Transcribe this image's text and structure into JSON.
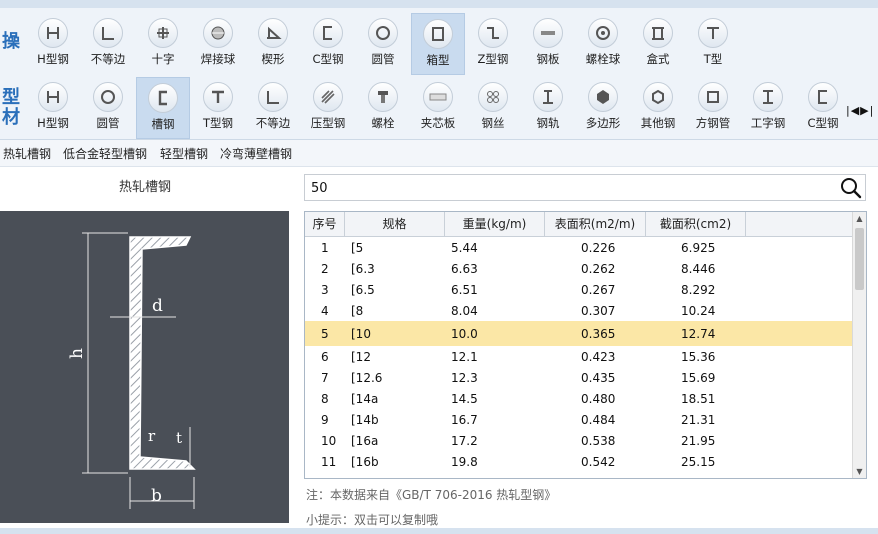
{
  "group_labels": {
    "top": "操",
    "bottom_1": "型",
    "bottom_2": "材"
  },
  "row1": [
    {
      "label": "H型钢",
      "icon": "h-beam-icon"
    },
    {
      "label": "不等边",
      "icon": "unequal-angle-icon"
    },
    {
      "label": "十字",
      "icon": "cross-section-icon"
    },
    {
      "label": "焊接球",
      "icon": "welded-ball-icon"
    },
    {
      "label": "楔形",
      "icon": "wedge-icon"
    },
    {
      "label": "C型钢",
      "icon": "c-channel-icon"
    },
    {
      "label": "圆管",
      "icon": "round-tube-icon"
    },
    {
      "label": "箱型",
      "icon": "box-section-icon",
      "active": true
    },
    {
      "label": "Z型钢",
      "icon": "z-section-icon"
    },
    {
      "label": "钢板",
      "icon": "steel-plate-icon"
    },
    {
      "label": "螺栓球",
      "icon": "bolt-ball-icon"
    },
    {
      "label": "盒式",
      "icon": "box-type-icon"
    },
    {
      "label": "T型",
      "icon": "t-section-icon"
    }
  ],
  "row2": [
    {
      "label": "H型钢",
      "icon": "h-beam-icon"
    },
    {
      "label": "圆管",
      "icon": "round-tube-icon"
    },
    {
      "label": "槽钢",
      "icon": "channel-steel-icon",
      "active": true
    },
    {
      "label": "T型钢",
      "icon": "t-steel-icon"
    },
    {
      "label": "不等边",
      "icon": "unequal-angle-icon"
    },
    {
      "label": "压型钢",
      "icon": "profiled-steel-icon"
    },
    {
      "label": "螺栓",
      "icon": "bolt-icon"
    },
    {
      "label": "夹芯板",
      "icon": "sandwich-panel-icon"
    },
    {
      "label": "钢丝",
      "icon": "steel-wire-icon"
    },
    {
      "label": "钢轨",
      "icon": "rail-icon"
    },
    {
      "label": "多边形",
      "icon": "polygon-icon"
    },
    {
      "label": "其他钢",
      "icon": "other-steel-icon"
    },
    {
      "label": "方钢管",
      "icon": "square-tube-icon"
    },
    {
      "label": "工字钢",
      "icon": "i-beam-icon"
    },
    {
      "label": "C型钢",
      "icon": "c-channel-icon"
    }
  ],
  "subtabs": [
    "热轧槽钢",
    "低合金轻型槽钢",
    "轻型槽钢",
    "冷弯薄壁槽钢"
  ],
  "panel_title": "热轧槽钢",
  "search": {
    "value": "50"
  },
  "diagram_labels": {
    "h": "h",
    "d": "d",
    "b": "b",
    "r": "r",
    "t": "t"
  },
  "table": {
    "headers": [
      "序号",
      "规格",
      "重量(kg/m)",
      "表面积(m2/m)",
      "截面积(cm2)"
    ],
    "rows": [
      [
        "1",
        "[5",
        "5.44",
        "0.226",
        "6.925"
      ],
      [
        "2",
        "[6.3",
        "6.63",
        "0.262",
        "8.446"
      ],
      [
        "3",
        "[6.5",
        "6.51",
        "0.267",
        "8.292"
      ],
      [
        "4",
        "[8",
        "8.04",
        "0.307",
        "10.24"
      ],
      [
        "5",
        "[10",
        "10.0",
        "0.365",
        "12.74"
      ],
      [
        "6",
        "[12",
        "12.1",
        "0.423",
        "15.36"
      ],
      [
        "7",
        "[12.6",
        "12.3",
        "0.435",
        "15.69"
      ],
      [
        "8",
        "[14a",
        "14.5",
        "0.480",
        "18.51"
      ],
      [
        "9",
        "[14b",
        "16.7",
        "0.484",
        "21.31"
      ],
      [
        "10",
        "[16a",
        "17.2",
        "0.538",
        "21.95"
      ],
      [
        "11",
        "[16b",
        "19.8",
        "0.542",
        "25.15"
      ]
    ],
    "selected_index": 4
  },
  "notes": {
    "source": "注：本数据来自《GB/T  706-2016  热轧型钢》",
    "tip": "小提示：双击可以复制哦"
  },
  "colors": {
    "accent": "#2a6fba",
    "selected_row": "#fbe7a6",
    "diagram_bg": "#4a4f57"
  }
}
